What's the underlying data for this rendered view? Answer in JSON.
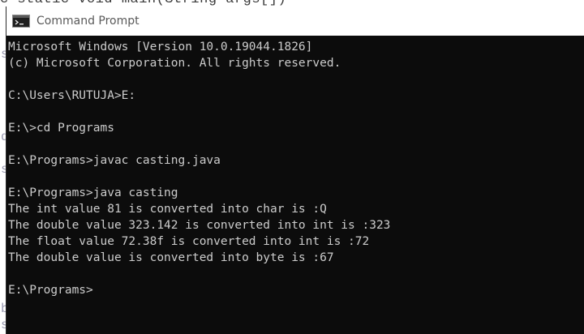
{
  "editor": {
    "visible_code_fragment": "c static void main(String args[])",
    "margin_glyphs": [
      "s",
      "d",
      "s",
      "b",
      "s"
    ]
  },
  "window": {
    "title": "Command Prompt",
    "icon": "cmd-terminal-icon"
  },
  "console": {
    "lines": [
      "Microsoft Windows [Version 10.0.19044.1826]",
      "(c) Microsoft Corporation. All rights reserved.",
      "",
      "C:\\Users\\RUTUJA>E:",
      "",
      "E:\\>cd Programs",
      "",
      "E:\\Programs>javac casting.java",
      "",
      "E:\\Programs>java casting",
      "The int value 81 is converted into char is :Q",
      "The double value 323.142 is converted into int is :323",
      "The float value 72.38f is converted into int is :72",
      "The double value is converted into byte is :67",
      "",
      "E:\\Programs>"
    ]
  },
  "colors": {
    "console_background": "#0c0c0c",
    "console_text": "#cccccc",
    "title_bar": "#ffffff",
    "title_text": "#5a5a5a"
  }
}
